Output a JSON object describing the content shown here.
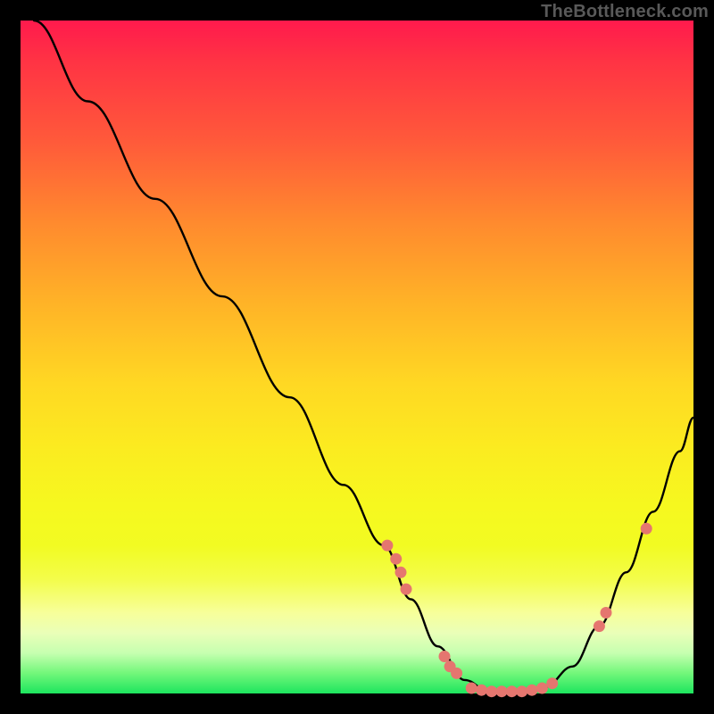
{
  "watermark": "TheBottleneck.com",
  "colors": {
    "curve": "#000000",
    "marker_fill": "#e5766f",
    "marker_stroke": "#e5766f"
  },
  "chart_data": {
    "type": "line",
    "title": "",
    "xlabel": "",
    "ylabel": "",
    "xlim": [
      0,
      100
    ],
    "ylim": [
      0,
      100
    ],
    "series": [
      {
        "name": "curve",
        "x": [
          2,
          10,
          20,
          30,
          40,
          48,
          54,
          58,
          62,
          66,
          70,
          74,
          78,
          82,
          86,
          90,
          94,
          98,
          100
        ],
        "y": [
          100,
          88,
          73.5,
          59,
          44,
          31,
          22,
          14,
          7,
          2,
          0,
          0,
          1,
          4,
          10,
          18,
          27,
          36,
          41
        ]
      }
    ],
    "markers": [
      {
        "x": 54.5,
        "y": 22.0
      },
      {
        "x": 55.8,
        "y": 20.0
      },
      {
        "x": 56.5,
        "y": 18.0
      },
      {
        "x": 57.3,
        "y": 15.5
      },
      {
        "x": 63.0,
        "y": 5.5
      },
      {
        "x": 63.8,
        "y": 4.0
      },
      {
        "x": 64.8,
        "y": 3.0
      },
      {
        "x": 67.0,
        "y": 0.8
      },
      {
        "x": 68.5,
        "y": 0.5
      },
      {
        "x": 70.0,
        "y": 0.3
      },
      {
        "x": 71.5,
        "y": 0.3
      },
      {
        "x": 73.0,
        "y": 0.3
      },
      {
        "x": 74.5,
        "y": 0.3
      },
      {
        "x": 76.0,
        "y": 0.5
      },
      {
        "x": 77.5,
        "y": 0.8
      },
      {
        "x": 79.0,
        "y": 1.5
      },
      {
        "x": 86.0,
        "y": 10.0
      },
      {
        "x": 87.0,
        "y": 12.0
      },
      {
        "x": 93.0,
        "y": 24.5
      }
    ]
  }
}
